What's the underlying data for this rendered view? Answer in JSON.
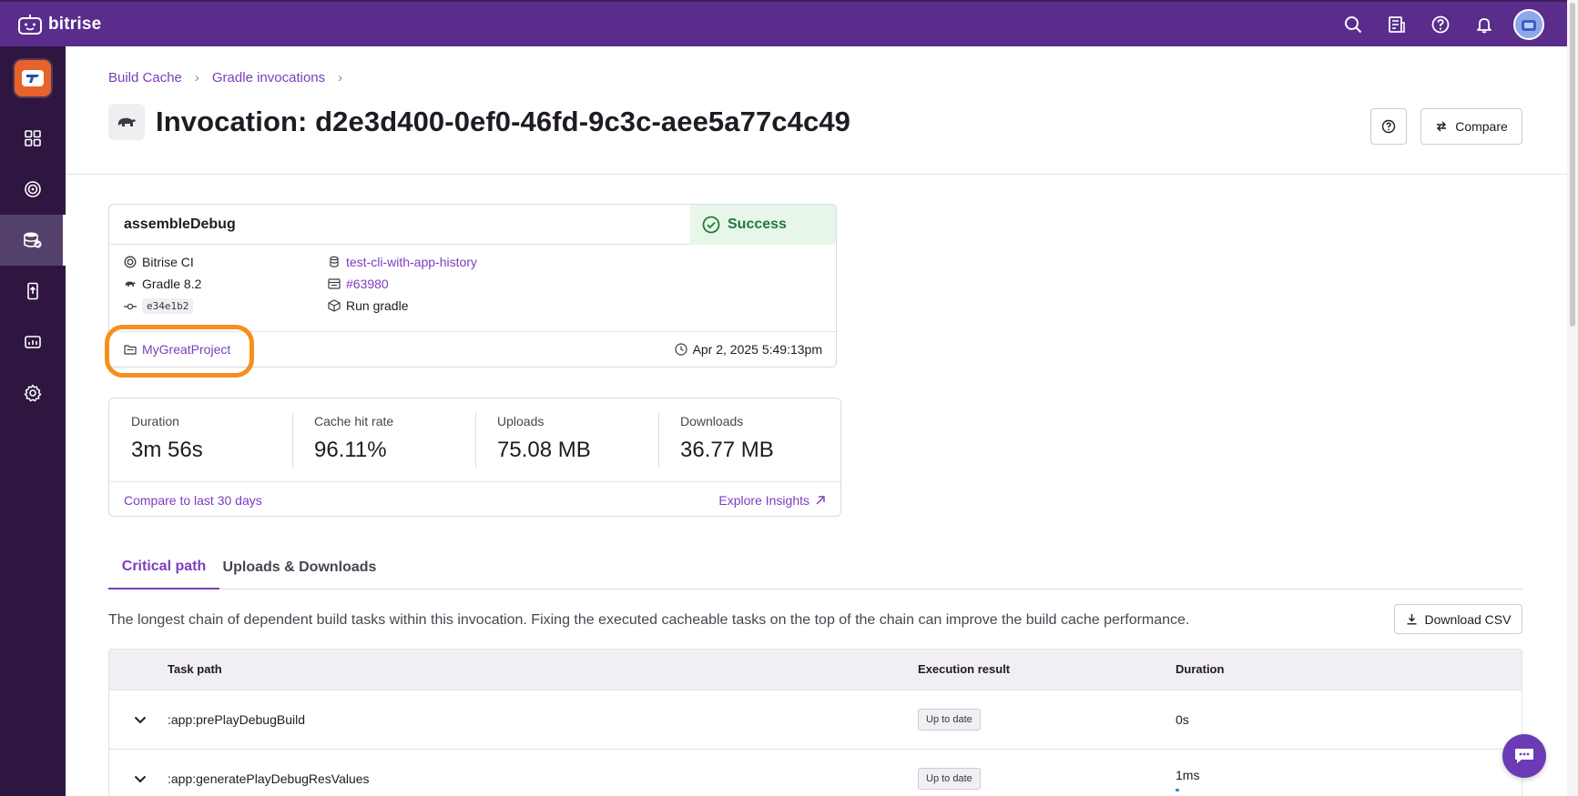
{
  "app": {
    "name": "bitrise"
  },
  "topbar": {
    "icons": [
      "search-icon",
      "changelog-icon",
      "help-icon",
      "bell-icon",
      "avatar"
    ]
  },
  "sidebar": {
    "items": [
      {
        "name": "dashboard-icon",
        "active": false
      },
      {
        "name": "insights-icon",
        "active": false
      },
      {
        "name": "build-cache-icon",
        "active": true
      },
      {
        "name": "release-icon",
        "active": false
      },
      {
        "name": "analytics-icon",
        "active": false
      },
      {
        "name": "settings-icon",
        "active": false
      }
    ]
  },
  "breadcrumb": {
    "items": [
      "Build Cache",
      "Gradle invocations"
    ]
  },
  "page": {
    "title": "Invocation: d2e3d400-0ef0-46fd-9c3c-aee5a77c4c49",
    "compare_label": "Compare"
  },
  "invocation": {
    "task": "assembleDebug",
    "status": "Success",
    "ci": "Bitrise CI",
    "gradle": "Gradle 8.2",
    "commit": "e34e1b2",
    "branch": "test-cli-with-app-history",
    "build": "#63980",
    "step": "Run gradle",
    "project": "MyGreatProject",
    "timestamp": "Apr 2, 2025 5:49:13pm"
  },
  "stats": {
    "duration": {
      "label": "Duration",
      "value": "3m 56s"
    },
    "hit_rate": {
      "label": "Cache hit rate",
      "value": "96.11%"
    },
    "uploads": {
      "label": "Uploads",
      "value": "75.08 MB"
    },
    "downloads": {
      "label": "Downloads",
      "value": "36.77 MB"
    },
    "compare_link": "Compare to last 30 days",
    "insights_link": "Explore Insights"
  },
  "tabs": [
    "Critical path",
    "Uploads & Downloads"
  ],
  "critical_path": {
    "description": "The longest chain of dependent build tasks within this invocation. Fixing the executed cacheable tasks on the top of the chain can improve the build cache performance.",
    "download_label": "Download CSV",
    "columns": {
      "task": "Task path",
      "result": "Execution result",
      "duration": "Duration"
    },
    "rows": [
      {
        "task": ":app:prePlayDebugBuild",
        "result": "Up to date",
        "duration": "0s"
      },
      {
        "task": ":app:generatePlayDebugResValues",
        "result": "Up to date",
        "duration": "1ms"
      }
    ]
  },
  "colors": {
    "brand": "#5a2d8c",
    "link": "#7d3cbf",
    "success": "#1f7a3a",
    "highlight": "#f5901e"
  }
}
